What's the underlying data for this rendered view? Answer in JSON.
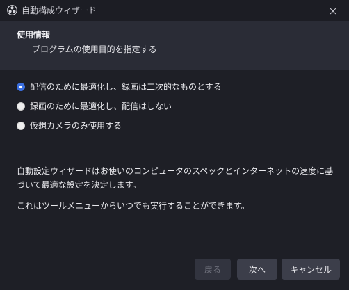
{
  "window": {
    "title": "自動構成ウィザード"
  },
  "header": {
    "title": "使用情報",
    "subtitle": "プログラムの使用目的を指定する"
  },
  "options": [
    {
      "label": "配信のために最適化し、録画は二次的なものとする",
      "checked": true
    },
    {
      "label": "録画のために最適化し、配信はしない",
      "checked": false
    },
    {
      "label": "仮想カメラのみ使用する",
      "checked": false
    }
  ],
  "description": {
    "line1": "自動設定ウィザードはお使いのコンピュータのスペックとインターネットの速度に基づいて最適な設定を決定します。",
    "line2": "これはツールメニューからいつでも実行することができます。"
  },
  "buttons": {
    "back": "戻る",
    "next": "次へ",
    "cancel": "キャンセル"
  },
  "colors": {
    "accent": "#3b6fe0",
    "background": "#1e1f26",
    "header_background": "#2a2c36"
  },
  "icons": {
    "app": "obs-logo-icon",
    "close": "close-icon"
  }
}
